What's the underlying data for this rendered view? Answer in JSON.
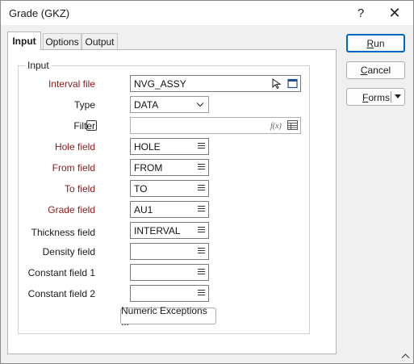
{
  "window": {
    "title": "Grade (GKZ)",
    "help": "?",
    "close": "✕"
  },
  "tabs": [
    {
      "label": "Input"
    },
    {
      "label": "Options"
    },
    {
      "label": "Output"
    }
  ],
  "group": {
    "label": "Input"
  },
  "fields": {
    "interval_file": {
      "label": "Interval file",
      "value": "NVG_ASSY"
    },
    "type": {
      "label": "Type",
      "value": "DATA"
    },
    "filter": {
      "label": "Filter",
      "value": "",
      "checked": false
    },
    "hole": {
      "label": "Hole field",
      "value": "HOLE"
    },
    "from": {
      "label": "From field",
      "value": "FROM"
    },
    "to": {
      "label": "To field",
      "value": "TO"
    },
    "grade": {
      "label": "Grade field",
      "value": "AU1"
    },
    "thickness": {
      "label": "Thickness field",
      "value": "INTERVAL"
    },
    "density": {
      "label": "Density field",
      "value": ""
    },
    "constant1": {
      "label": "Constant field 1",
      "value": ""
    },
    "constant2": {
      "label": "Constant field 2",
      "value": ""
    }
  },
  "numeric_exceptions": {
    "label": "Numeric Exceptions ..."
  },
  "buttons": {
    "run": {
      "label_u": "R",
      "label_rest": "un"
    },
    "cancel": {
      "label_u": "C",
      "label_rest": "ancel"
    },
    "forms": {
      "label_u": "F",
      "label_rest": "orms"
    }
  },
  "colors": {
    "required_label": "#8b1a1a",
    "accent": "#0067c0"
  }
}
